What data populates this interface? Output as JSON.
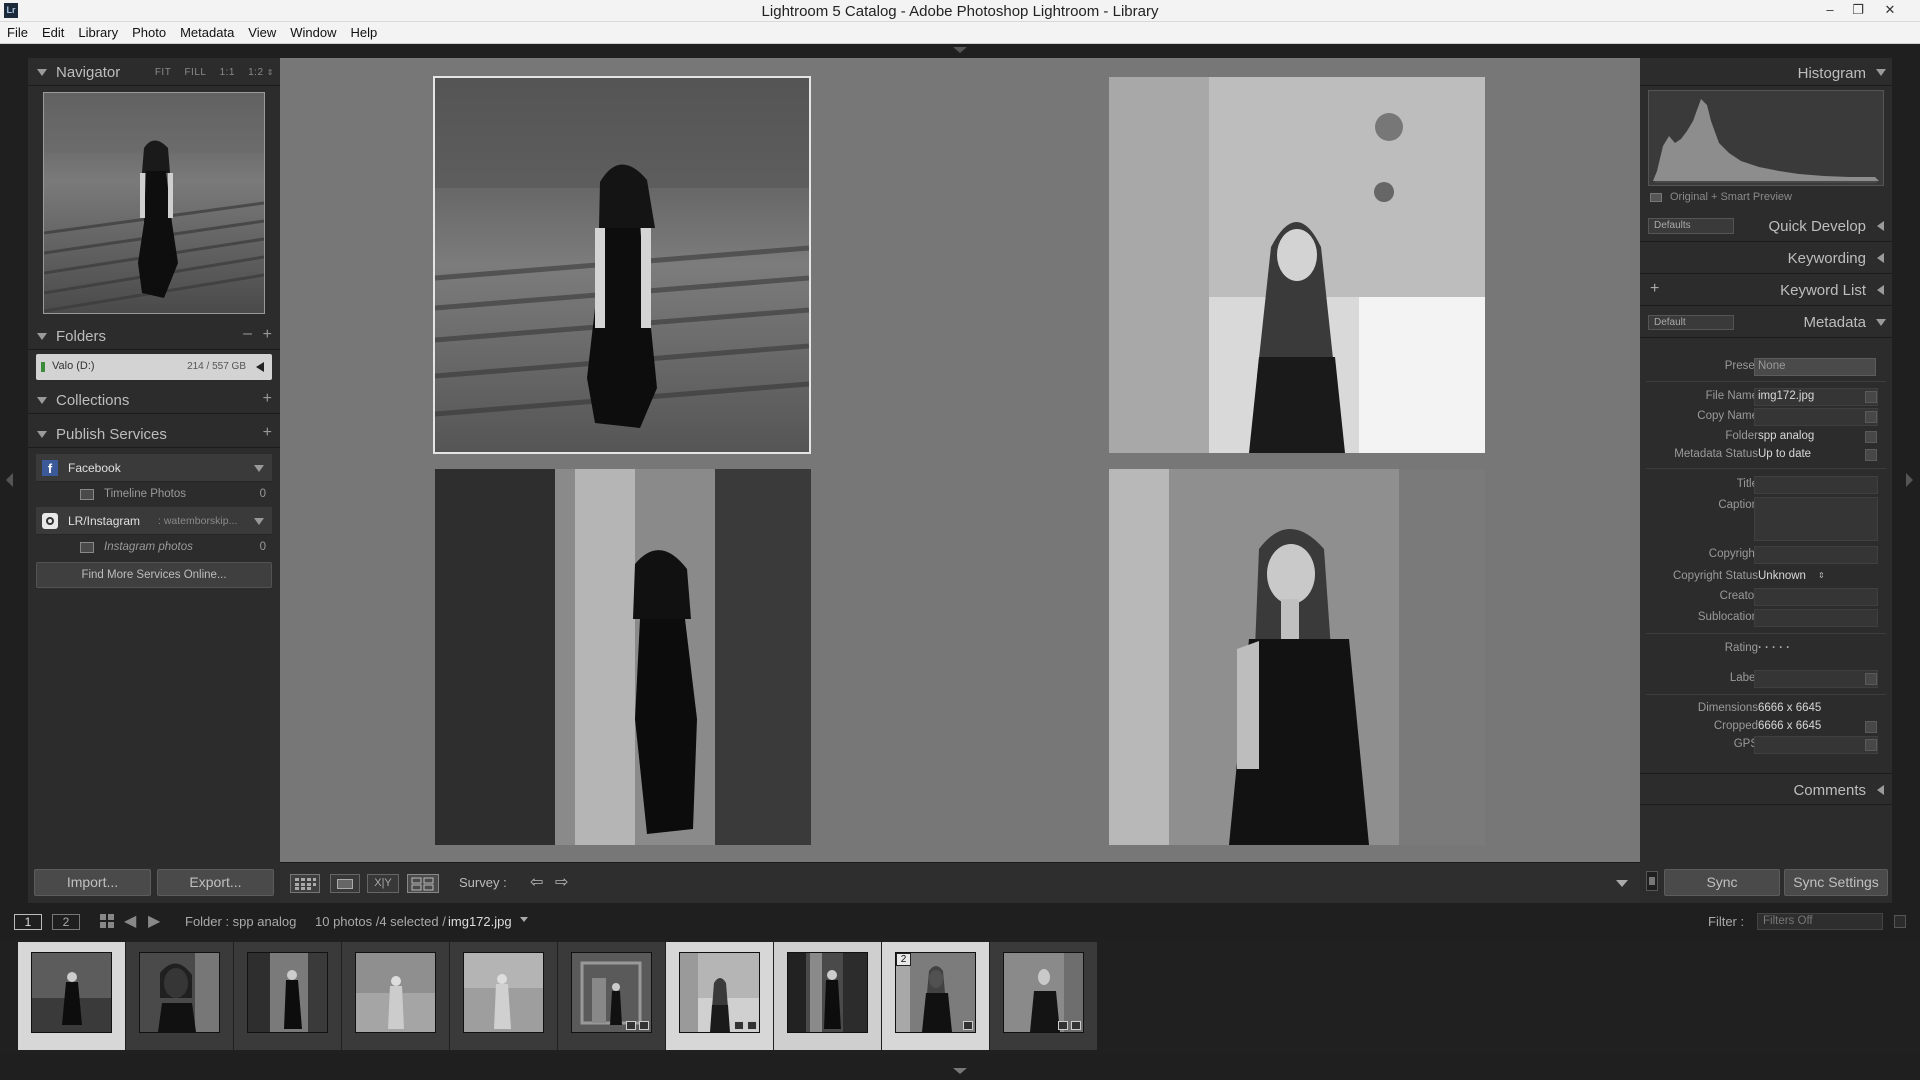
{
  "window": {
    "app_icon": "Lr",
    "title": "Lightroom 5 Catalog - Adobe Photoshop Lightroom - Library",
    "minimize": "–",
    "restore": "❐",
    "close": "✕"
  },
  "menu": [
    "File",
    "Edit",
    "Library",
    "Photo",
    "Metadata",
    "View",
    "Window",
    "Help"
  ],
  "left": {
    "navigator": {
      "title": "Navigator",
      "zoom": [
        "FIT",
        "FILL",
        "1:1",
        "1:2"
      ]
    },
    "folders": {
      "title": "Folders",
      "drive_name": "Valo (D:)",
      "drive_space": "214 / 557 GB",
      "drive_fill": 0.38
    },
    "collections": {
      "title": "Collections"
    },
    "publish": {
      "title": "Publish Services",
      "services": [
        {
          "icon": "facebook-icon",
          "name": "Facebook",
          "account": "",
          "sub": "Timeline Photos",
          "count": "0"
        },
        {
          "icon": "instagram-icon",
          "name": "LR/Instagram",
          "account": ": watemborskip...",
          "sub": "Instagram photos",
          "count": "0"
        }
      ],
      "find_more": "Find More Services Online..."
    },
    "import_label": "Import...",
    "export_label": "Export..."
  },
  "right": {
    "histogram": {
      "title": "Histogram",
      "preview_label": "Original + Smart Preview"
    },
    "quick_develop": {
      "title": "Quick Develop",
      "preset": "Defaults"
    },
    "keywording": {
      "title": "Keywording"
    },
    "keyword_list": {
      "title": "Keyword List"
    },
    "metadata": {
      "title": "Metadata",
      "preset_menu": "Default",
      "preset_label": "Preset",
      "preset_value": "None",
      "fields": {
        "file_name_label": "File Name",
        "file_name": "img172.jpg",
        "copy_name_label": "Copy Name",
        "folder_label": "Folder",
        "folder": "spp analog",
        "metadata_status_label": "Metadata Status",
        "metadata_status": "Up to date",
        "title_label": "Title",
        "caption_label": "Caption",
        "copyright_label": "Copyright",
        "copyright_status_label": "Copyright Status",
        "copyright_status": "Unknown",
        "creator_label": "Creator",
        "sublocation_label": "Sublocation",
        "rating_label": "Rating",
        "rating_value": "·  ·  ·  ·  ·",
        "label_label": "Label",
        "dimensions_label": "Dimensions",
        "dimensions": "6666 x 6645",
        "cropped_label": "Cropped",
        "cropped": "6666 x 6645",
        "gps_label": "GPS"
      }
    },
    "comments": {
      "title": "Comments"
    },
    "sync_label": "Sync",
    "sync_settings_label": "Sync Settings"
  },
  "toolbar": {
    "survey_label": "Survey :"
  },
  "filmstrip": {
    "page1": "1",
    "page2": "2",
    "source": "Folder : spp analog",
    "count": "10 photos /4 selected /",
    "filename": "img172.jpg",
    "filter_label": "Filter :",
    "filter_value": "Filters Off",
    "thumb_badge": "2"
  }
}
